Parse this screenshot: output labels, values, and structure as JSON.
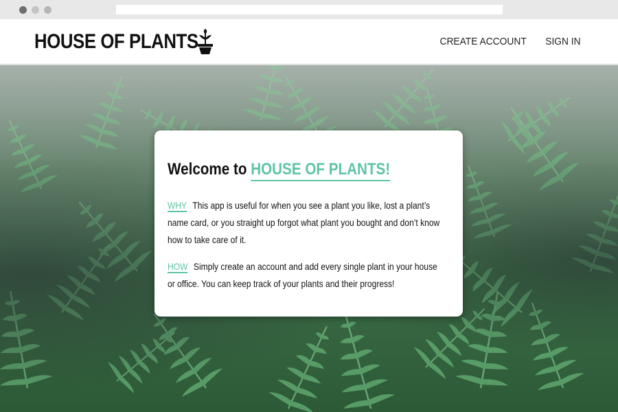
{
  "browser": {
    "address": ""
  },
  "header": {
    "brand": "HOUSE OF PLANTS",
    "logo_icon": "potted-plant-icon",
    "nav": [
      {
        "label": "CREATE ACCOUNT"
      },
      {
        "label": "SIGN IN"
      }
    ]
  },
  "card": {
    "welcome_prefix": "Welcome to",
    "welcome_brand": "HOUSE OF PLANTS!",
    "why_tag": "WHY",
    "why_text": "This app is useful for when you see a plant you like, lost a plant’s name card, or you straight up forgot what plant you bought and don’t know how to take care of it.",
    "how_tag": "HOW",
    "how_text": "Simply create an account and add every single plant in your house or office. You can keep track of your plants and their progress!"
  },
  "colors": {
    "accent": "#5ec4a6",
    "text": "#111111",
    "header_bg": "#ffffff"
  }
}
